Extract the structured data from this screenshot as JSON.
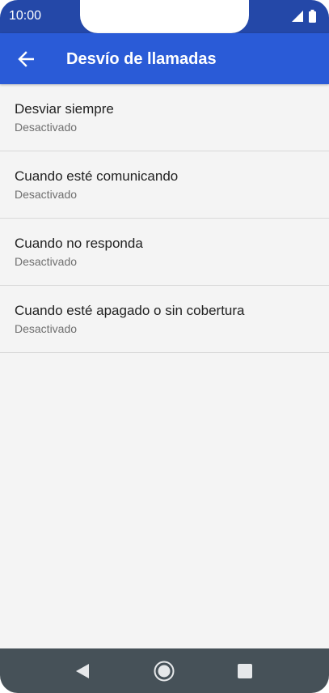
{
  "status_bar": {
    "time": "10:00",
    "icons": [
      "signal-icon",
      "battery-icon"
    ]
  },
  "app_bar": {
    "title": "Desvío de llamadas",
    "back_icon": "back-arrow-icon"
  },
  "list": {
    "items": [
      {
        "title": "Desviar siempre",
        "subtitle": "Desactivado"
      },
      {
        "title": "Cuando esté comunicando",
        "subtitle": "Desactivado"
      },
      {
        "title": "Cuando no responda",
        "subtitle": "Desactivado"
      },
      {
        "title": "Cuando esté apagado o sin cobertura",
        "subtitle": "Desactivado"
      }
    ]
  },
  "nav_bar": {
    "buttons": [
      "nav-back-icon",
      "nav-home-icon",
      "nav-recents-icon"
    ]
  },
  "colors": {
    "status_bar": "#2448a8",
    "app_bar": "#2a5bd7",
    "background": "#f4f4f4",
    "nav_bar": "#465158"
  }
}
